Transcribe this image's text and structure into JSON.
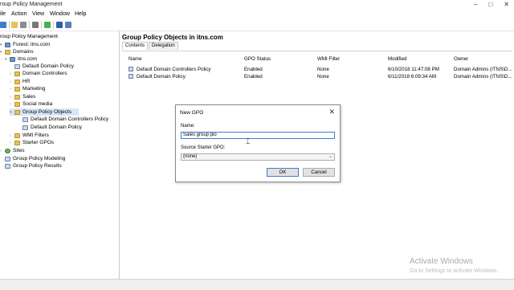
{
  "window": {
    "title": "roup Policy Management",
    "controls": [
      "–",
      "□",
      "✕"
    ]
  },
  "menu": [
    "ile",
    "Action",
    "View",
    "Window",
    "Help"
  ],
  "tree": {
    "root": "roup Policy Management",
    "forest": "Forest: itns.com",
    "domains": "Domains",
    "domain": "itns.com",
    "children": [
      "Default Domain Policy",
      "Domain Controllers",
      "HR",
      "Marketing",
      "Sales",
      "Social media",
      "Group Policy Objects"
    ],
    "gpo_children": [
      "Default Domain Controllers Policy",
      "Default Domain Policy"
    ],
    "after": [
      "WMI Filters",
      "Starter GPOs"
    ],
    "bottom": [
      "Sites",
      "Group Policy Modeling",
      "Group Policy Results"
    ]
  },
  "right": {
    "title": "Group Policy Objects in itns.com",
    "tabs": [
      "Contents",
      "Delegation"
    ],
    "columns": [
      "Name",
      "GPO Status",
      "WMI Filter",
      "Modified",
      "Owner"
    ],
    "rows": [
      {
        "name": "Default Domain Controllers Policy",
        "status": "Enabled",
        "wmi": "None",
        "modified": "6/10/2018 11:47:08 PM",
        "owner": "Domain Admins (ITNS\\D..."
      },
      {
        "name": "Default Domain Policy",
        "status": "Enabled",
        "wmi": "None",
        "modified": "6/11/2018 6:09:34 AM",
        "owner": "Domain Admins (ITNS\\D..."
      }
    ]
  },
  "dialog": {
    "title": "New GPO",
    "close": "✕",
    "name_label": "Name:",
    "name_value": "Sales group plo",
    "source_label": "Source Starter GPO:",
    "source_value": "(none)",
    "ok": "OK",
    "cancel": "Cancel"
  },
  "watermark": {
    "line1": "Activate Windows",
    "line2": "Go to Settings to activate Windows."
  }
}
